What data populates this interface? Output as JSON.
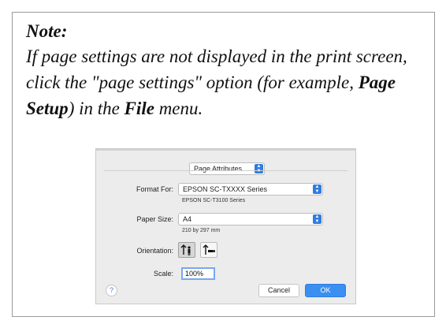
{
  "note": {
    "title": "Note:",
    "text_before": "If page settings are not displayed in the print screen, click the \"page settings\" option (for example, ",
    "text_bold_1": "Page Setup",
    "text_middle": ") in the ",
    "text_bold_2": "File",
    "text_after": " menu."
  },
  "dialog": {
    "attributes_popup": "Page Attributes",
    "format_for_label": "Format For:",
    "format_for_value": "EPSON SC-TXXXX Series",
    "format_for_sub": "EPSON SC-T3100 Series",
    "paper_size_label": "Paper Size:",
    "paper_size_value": "A4",
    "paper_size_sub": "210 by 297 mm",
    "orientation_label": "Orientation:",
    "scale_label": "Scale:",
    "scale_value": "100%",
    "help_label": "?",
    "cancel_label": "Cancel",
    "ok_label": "OK"
  }
}
